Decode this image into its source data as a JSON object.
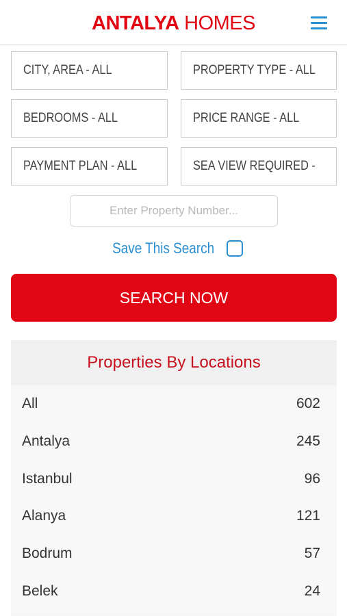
{
  "header": {
    "logo_brand": "ANTALYA",
    "logo_sub": " HOMES",
    "menu_icon": "hamburger-menu-icon"
  },
  "filters": {
    "city": "CITY, AREA - ALL",
    "property_type": "PROPERTY TYPE - ALL",
    "bedrooms": "BEDROOMS - ALL",
    "price_range": "PRICE RANGE - ALL",
    "payment_plan": "PAYMENT PLAN - ALL",
    "sea_view": "SEA VIEW REQUIRED -"
  },
  "property_number": {
    "placeholder": "Enter Property Number...",
    "value": ""
  },
  "save_search": {
    "label": "Save This Search",
    "checked": false
  },
  "search_button": "SEARCH NOW",
  "locations": {
    "title": "Properties By Locations",
    "items": [
      {
        "name": "All",
        "count": "602"
      },
      {
        "name": "Antalya",
        "count": "245"
      },
      {
        "name": "Istanbul",
        "count": "96"
      },
      {
        "name": "Alanya",
        "count": "121"
      },
      {
        "name": "Bodrum",
        "count": "57"
      },
      {
        "name": "Belek",
        "count": "24"
      }
    ]
  },
  "colors": {
    "brand_red": "#e10613",
    "accent_blue": "#2a8fd0"
  }
}
